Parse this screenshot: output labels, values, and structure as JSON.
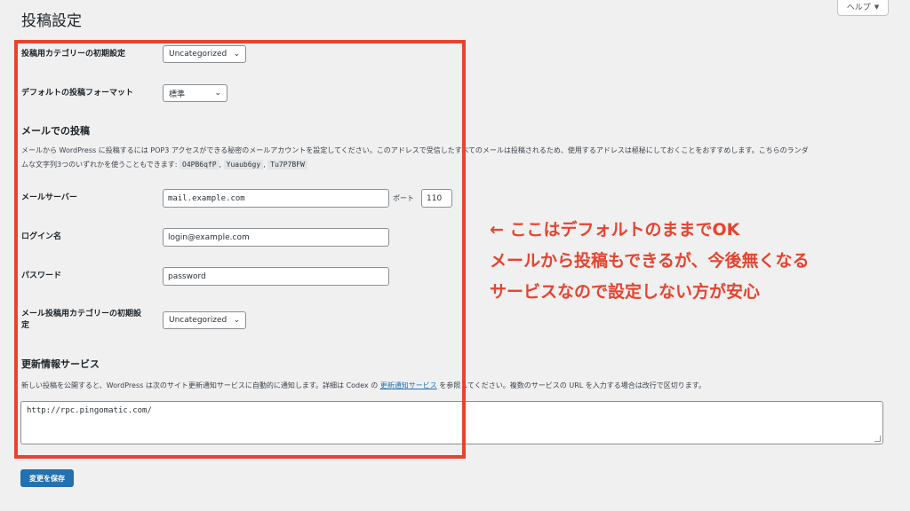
{
  "page_title": "投稿設定",
  "help": {
    "label": "ヘルプ",
    "caret": "▼"
  },
  "default_category": {
    "label": "投稿用カテゴリーの初期設定",
    "value": "Uncategorized"
  },
  "default_format": {
    "label": "デフォルトの投稿フォーマット",
    "value": "標準"
  },
  "post_via_email": {
    "title": "メールでの投稿",
    "description_line1": "メールから WordPress に投稿するには POP3 アクセスができる秘密のメールアカウントを設定してください。このアドレスで受信したすべてのメールは投稿されるため、使用するアドレスは極秘にしておくことをおすすめします。こちらのランダ",
    "description_line2_prefix": "ムな文字列3つのいずれかを使うこともできます:",
    "random_strings": [
      "O4PB6qfP",
      "Yuaub6gy",
      "Tu7P7BFW"
    ],
    "separator": ",",
    "mail_server": {
      "label": "メールサーバー",
      "value": "mail.example.com"
    },
    "port": {
      "label": "ポート",
      "value": "110"
    },
    "login_name": {
      "label": "ログイン名",
      "value": "login@example.com"
    },
    "password": {
      "label": "パスワード",
      "value": "password"
    },
    "mail_category": {
      "label_line1": "メール投稿用カテゴリーの初期設",
      "label_line2": "定",
      "value": "Uncategorized"
    }
  },
  "update_services": {
    "title": "更新情報サービス",
    "description_before": "新しい投稿を公開すると、WordPress は次のサイト更新通知サービスに自動的に通知します。詳細は Codex の ",
    "link_text": "更新通知サービス",
    "description_after": " を参照してください。複数のサービスの URL を入力する場合は改行で区切ります。",
    "value": "http://rpc.pingomatic.com/"
  },
  "save_button": "変更を保存",
  "annotation": {
    "line1": "← ここはデフォルトのままでOK",
    "line2": "メールから投稿もできるが、今後無くなる",
    "line3": "サービスなので設定しない方が安心"
  },
  "colors": {
    "highlight": "#e8432f",
    "primary_button": "#2271b1",
    "background": "#f0f0f1"
  }
}
